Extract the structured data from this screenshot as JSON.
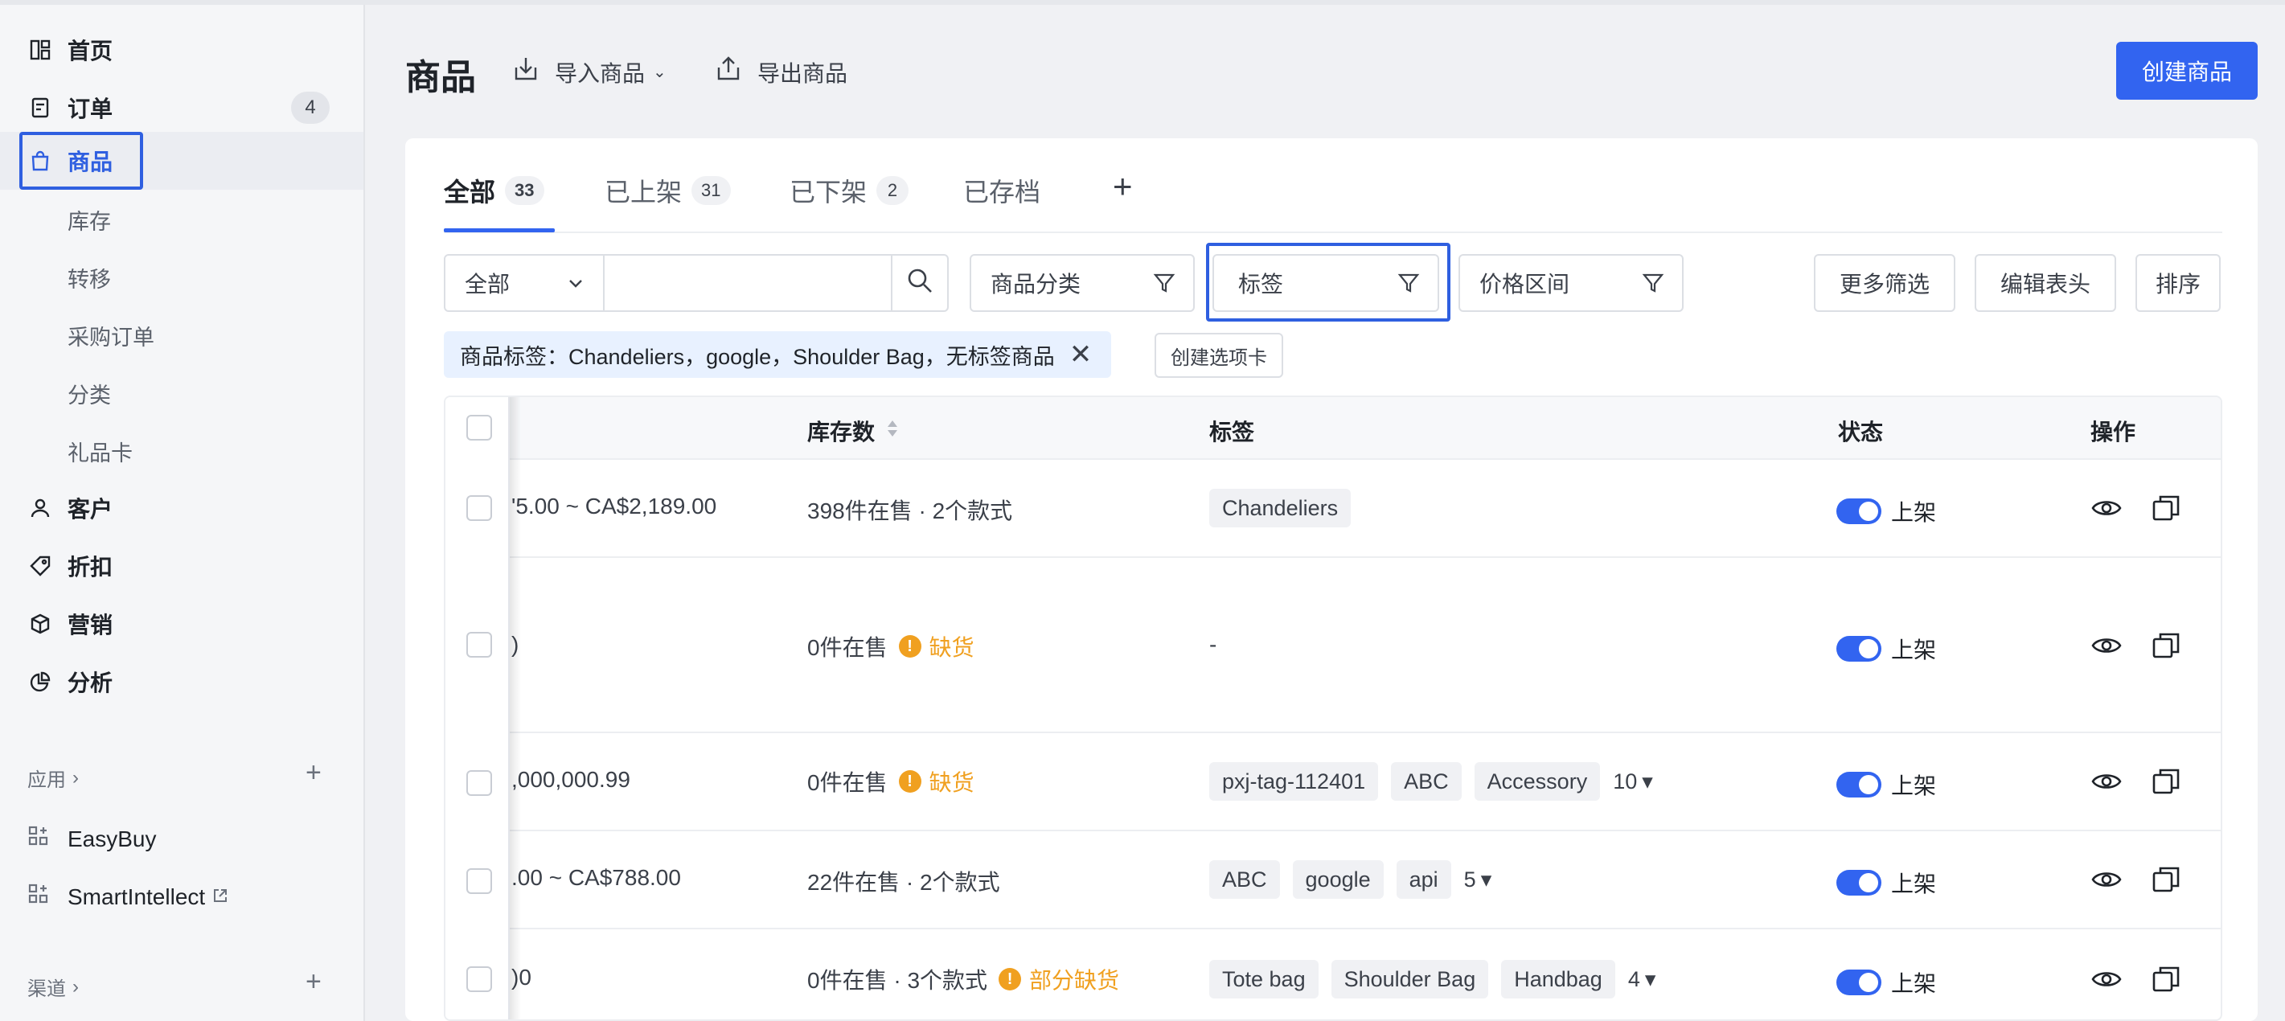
{
  "sidebar": {
    "nav": [
      {
        "label": "首页",
        "icon": "dashboard-icon"
      },
      {
        "label": "订单",
        "icon": "order-icon",
        "badge": "4"
      },
      {
        "label": "商品",
        "icon": "shopping-bag-icon"
      }
    ],
    "products_sub": [
      "库存",
      "转移",
      "采购订单",
      "分类",
      "礼品卡"
    ],
    "nav2": [
      {
        "label": "客户",
        "icon": "user-icon"
      },
      {
        "label": "折扣",
        "icon": "tag-icon"
      },
      {
        "label": "营销",
        "icon": "cube-icon"
      },
      {
        "label": "分析",
        "icon": "pie-chart-icon"
      }
    ],
    "apps_title": "应用",
    "apps": [
      "EasyBuy",
      "SmartIntellect"
    ],
    "channels_title": "渠道"
  },
  "header": {
    "title": "商品",
    "import_label": "导入商品",
    "export_label": "导出商品",
    "create_label": "创建商品"
  },
  "tabs": [
    {
      "label": "全部",
      "count": "33"
    },
    {
      "label": "已上架",
      "count": "31"
    },
    {
      "label": "已下架",
      "count": "2"
    },
    {
      "label": "已存档",
      "count": ""
    }
  ],
  "filters": {
    "scope_select": "全部",
    "search_placeholder": "",
    "category": "商品分类",
    "tags": "标签",
    "price": "价格区间",
    "more": "更多筛选",
    "edit_columns": "编辑表头",
    "sort": "排序",
    "active_chip": "商品标签：Chandeliers，google，Shoulder Bag，无标签商品",
    "create_view": "创建选项卡"
  },
  "table": {
    "headers": {
      "stock": "库存数",
      "tags": "标签",
      "status": "状态",
      "actions": "操作"
    },
    "rows": [
      {
        "price": "'5.00 ~ CA$2,189.00",
        "stock": "398件在售 · 2个款式",
        "warn": "",
        "tags": [
          "Chandeliers"
        ],
        "more": "",
        "status": "上架"
      },
      {
        "price": ")",
        "stock": "0件在售",
        "warn": "缺货",
        "tags": [],
        "no_tag": "-",
        "more": "",
        "status": "上架"
      },
      {
        "price": ",000,000.99",
        "stock": "0件在售",
        "warn": "缺货",
        "tags": [
          "pxj-tag-112401",
          "ABC",
          "Accessory"
        ],
        "more": "10",
        "status": "上架"
      },
      {
        "price": ".00 ~ CA$788.00",
        "stock": "22件在售 · 2个款式",
        "warn": "",
        "tags": [
          "ABC",
          "google",
          "api"
        ],
        "more": "5",
        "status": "上架"
      },
      {
        "price": ")0",
        "stock": "0件在售 · 3个款式",
        "warn": "部分缺货",
        "tags": [
          "Tote bag",
          "Shoulder Bag",
          "Handbag"
        ],
        "more": "4",
        "status": "上架"
      }
    ]
  },
  "colors": {
    "accent": "#3264f0",
    "warning": "#f0a020"
  }
}
